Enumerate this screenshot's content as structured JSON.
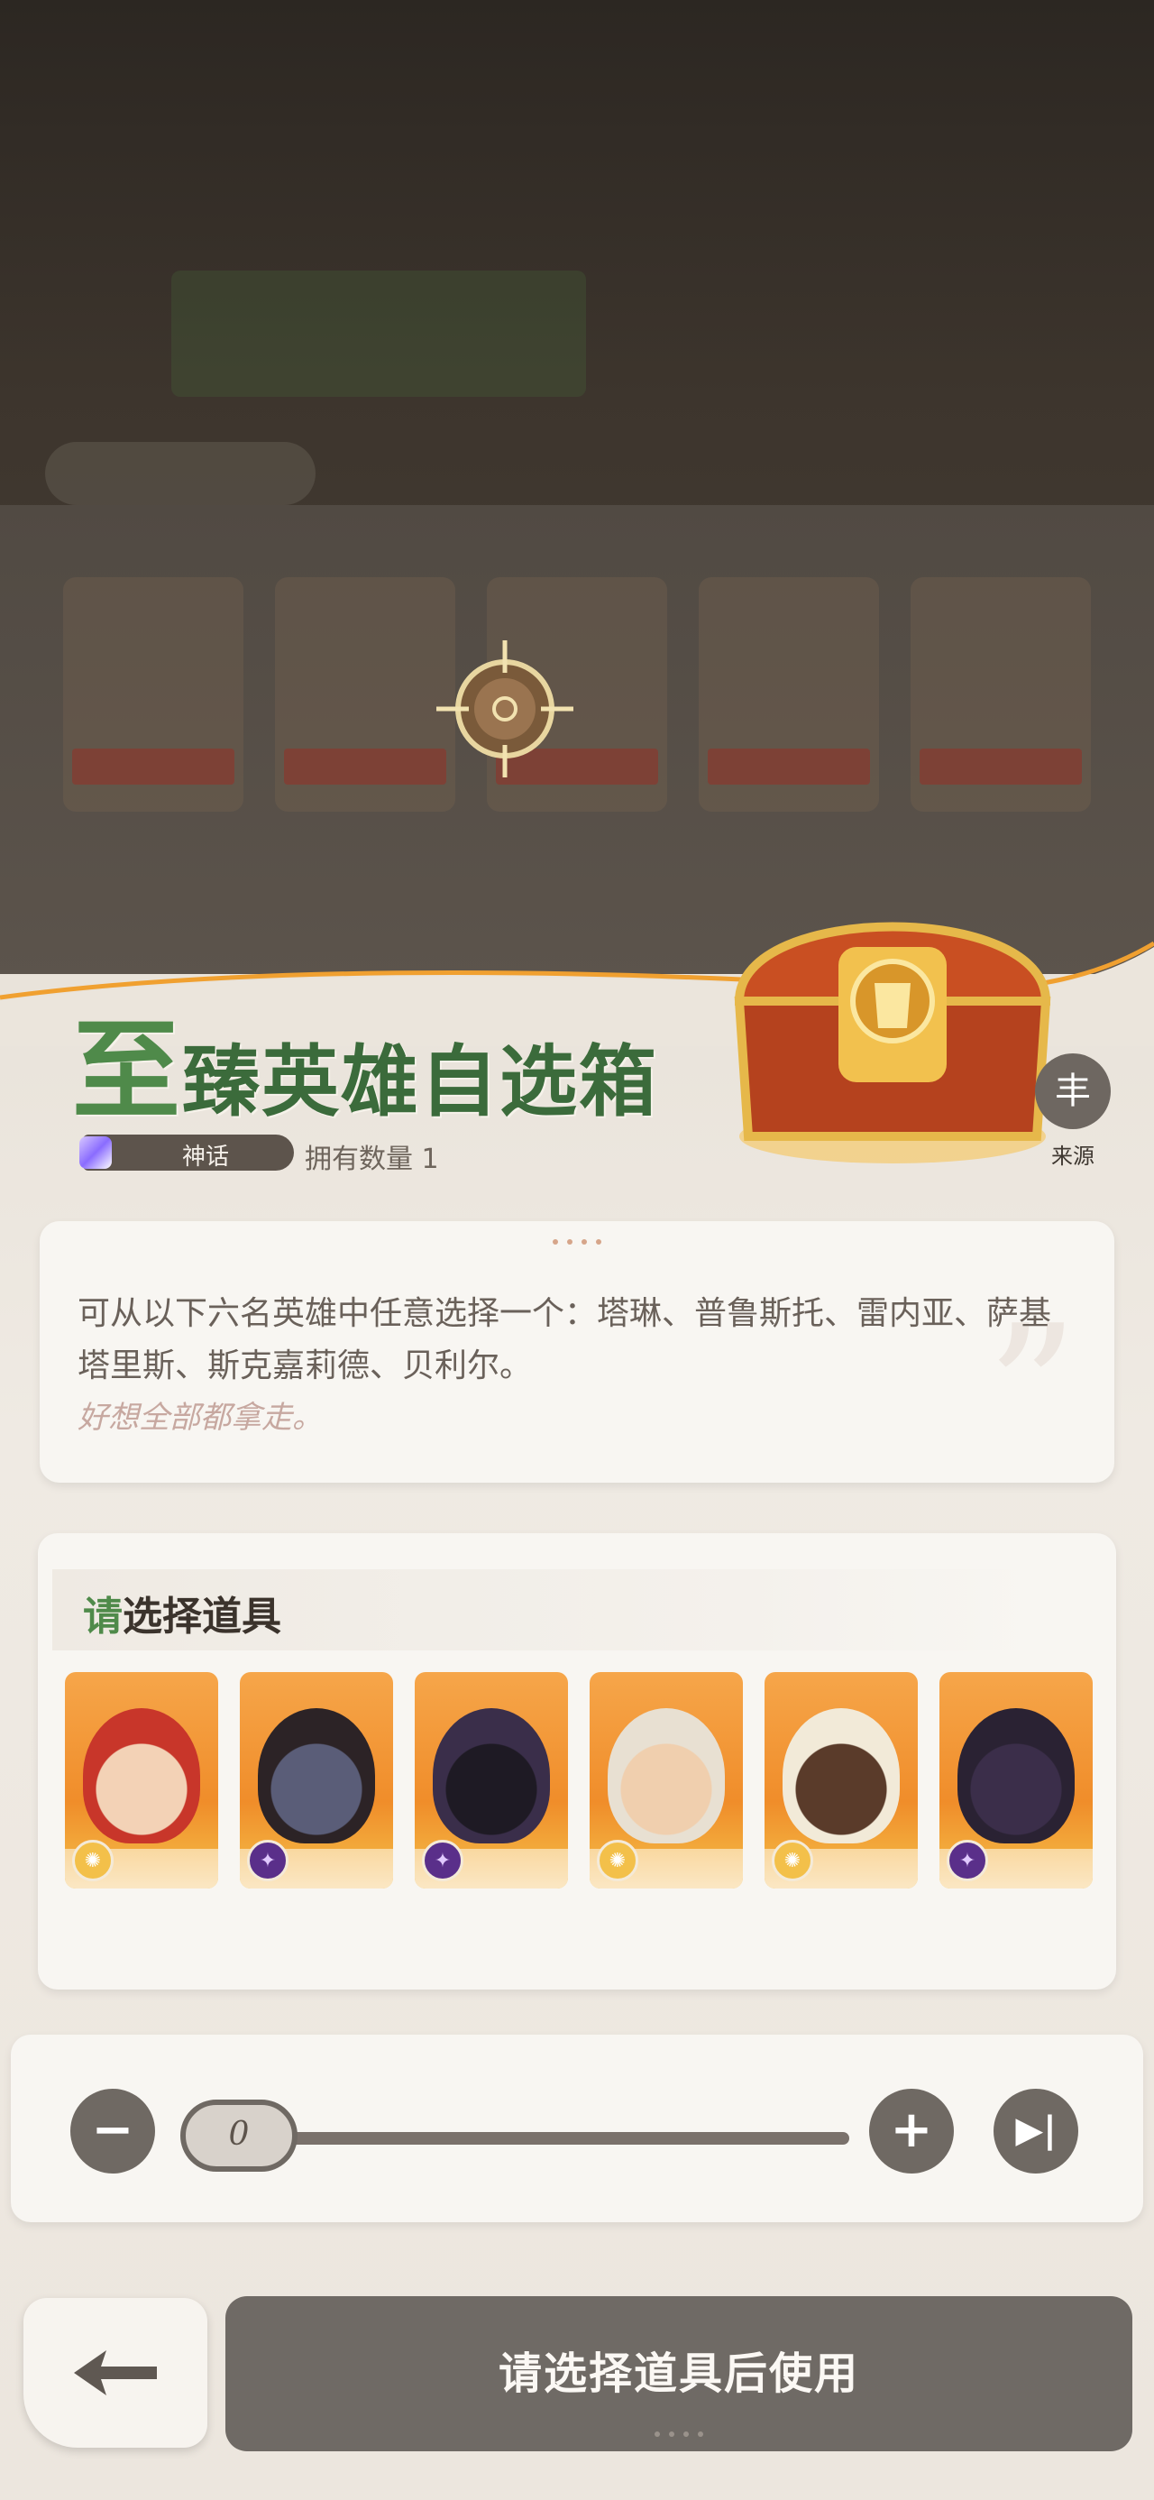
{
  "chest": {
    "title": "至臻英雄自选箱",
    "rarity": "神话",
    "owned": "拥有数量 1",
    "source_label": "来源",
    "source_icon": "丰"
  },
  "description": {
    "text": "可从以下六名英雄中任意选择一个：塔琳、普鲁斯托、雷内亚、萨基塔里斯、斯克嘉莉德、贝利尔。",
    "flavor": "好想全部都拿走。"
  },
  "selection": {
    "title_accent": "请",
    "title_rest": "选择道具",
    "heroes": [
      {
        "faction_icon": "star-faction-icon",
        "hair": "#c8362a",
        "skin": "#f3d2b6"
      },
      {
        "faction_icon": "arcane-faction-icon",
        "hair": "#2c2326",
        "skin": "#5a5d78"
      },
      {
        "faction_icon": "arcane-faction-icon",
        "hair": "#3a2e4a",
        "skin": "#1e1a24"
      },
      {
        "faction_icon": "star-faction-icon",
        "hair": "#e8e0d2",
        "skin": "#f0cfae"
      },
      {
        "faction_icon": "star-faction-icon",
        "hair": "#f2ead8",
        "skin": "#5a3b2a"
      },
      {
        "faction_icon": "arcane-faction-icon",
        "hair": "#2a2233",
        "skin": "#3b2e4a"
      }
    ]
  },
  "quantity": {
    "value": "0",
    "minus": "−",
    "plus": "+",
    "max": "▶|"
  },
  "actions": {
    "use_label": "请选择道具后使用"
  },
  "colors": {
    "accent_green": "#4f8a4a",
    "button_gray": "#6f6a65"
  }
}
